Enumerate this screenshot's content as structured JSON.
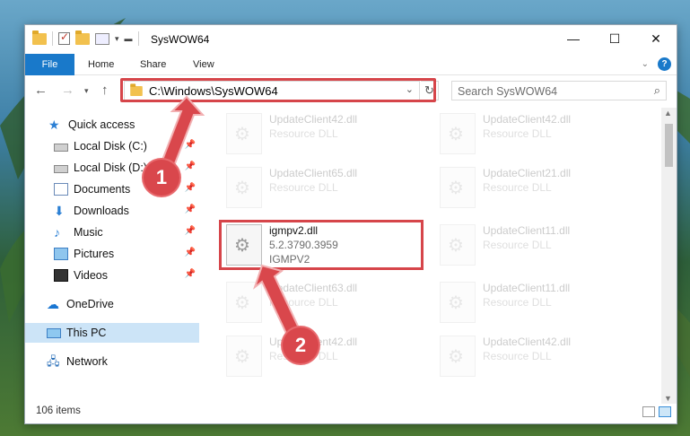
{
  "window": {
    "title": "SysWOW64",
    "controls": [
      "—",
      "☐",
      "✕"
    ]
  },
  "ribbon": {
    "tabs": [
      "File",
      "Home",
      "Share",
      "View"
    ]
  },
  "navbar": {
    "address": "C:\\Windows\\SysWOW64",
    "search_placeholder": "Search SysWOW64"
  },
  "navpane": {
    "items": [
      {
        "label": "Quick access",
        "icon": "star-icon"
      },
      {
        "label": "Local Disk (C:)",
        "icon": "drive-icon"
      },
      {
        "label": "Local Disk (D:)",
        "icon": "drive-icon"
      },
      {
        "label": "Documents",
        "icon": "documents-icon"
      },
      {
        "label": "Downloads",
        "icon": "downloads-icon"
      },
      {
        "label": "Music",
        "icon": "music-icon"
      },
      {
        "label": "Pictures",
        "icon": "pictures-icon"
      },
      {
        "label": "Videos",
        "icon": "videos-icon"
      },
      {
        "label": "OneDrive",
        "icon": "onedrive-icon"
      },
      {
        "label": "This PC",
        "icon": "this-pc-icon"
      },
      {
        "label": "Network",
        "icon": "network-icon"
      }
    ]
  },
  "files": {
    "left": [
      {
        "name": "UpdateClient42.dll",
        "type": "Resource DLL"
      },
      {
        "name": "UpdateClient65.dll",
        "type": "Resource DLL"
      },
      {
        "name": "igmpv2.dll",
        "version": "5.2.3790.3959",
        "desc": "IGMPV2"
      },
      {
        "name": "UpdateClient63.dll",
        "type": "Resource DLL"
      },
      {
        "name": "UpdateClient42.dll",
        "type": "Resource DLL"
      }
    ],
    "right": [
      {
        "name": "UpdateClient42.dll",
        "type": "Resource DLL"
      },
      {
        "name": "UpdateClient21.dll",
        "type": "Resource DLL"
      },
      {
        "name": "UpdateClient11.dll",
        "type": "Resource DLL"
      },
      {
        "name": "UpdateClient11.dll",
        "type": "Resource DLL"
      },
      {
        "name": "UpdateClient42.dll",
        "type": "Resource DLL"
      }
    ]
  },
  "status": {
    "item_count": "106 items"
  },
  "annotations": {
    "step1": "1",
    "step2": "2",
    "highlight_color": "#d6454a"
  }
}
